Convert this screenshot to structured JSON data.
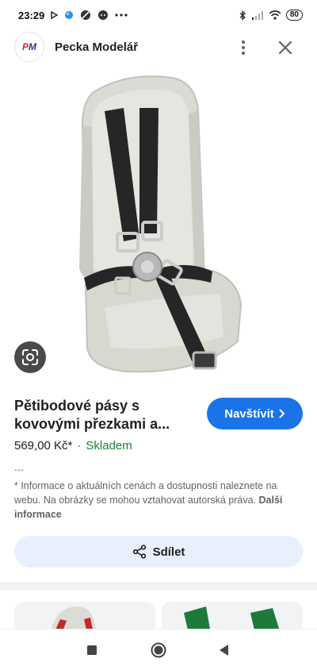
{
  "status_bar": {
    "time": "23:29",
    "left_icons": [
      "play-icon",
      "blue-dot-icon",
      "circle-slash-icon",
      "chat-icon",
      "more-dots-icon"
    ],
    "right_icons": [
      "bluetooth-icon",
      "signal-icon",
      "wifi-icon"
    ],
    "battery": "80"
  },
  "header": {
    "logo_p": "P",
    "logo_m": "M",
    "site_name": "Pecka Modelář"
  },
  "product": {
    "title": "Pětibodové pásy s kovovými přezkami a...",
    "visit_label": "Navštívit",
    "price": "569,00 Kč*",
    "separator": "·",
    "stock": "Skladem",
    "ellipsis": "...",
    "info_text": "* Informace o aktuálních cenách a dostupnosti naleznete na webu. Na obrázky se mohou vztahovat autorská práva.",
    "info_link": "Další informace"
  },
  "actions": {
    "share_label": "Sdílet"
  },
  "colors": {
    "accent": "#1a73e8",
    "stock_green": "#188038",
    "share_bg": "#e8f0fe"
  }
}
